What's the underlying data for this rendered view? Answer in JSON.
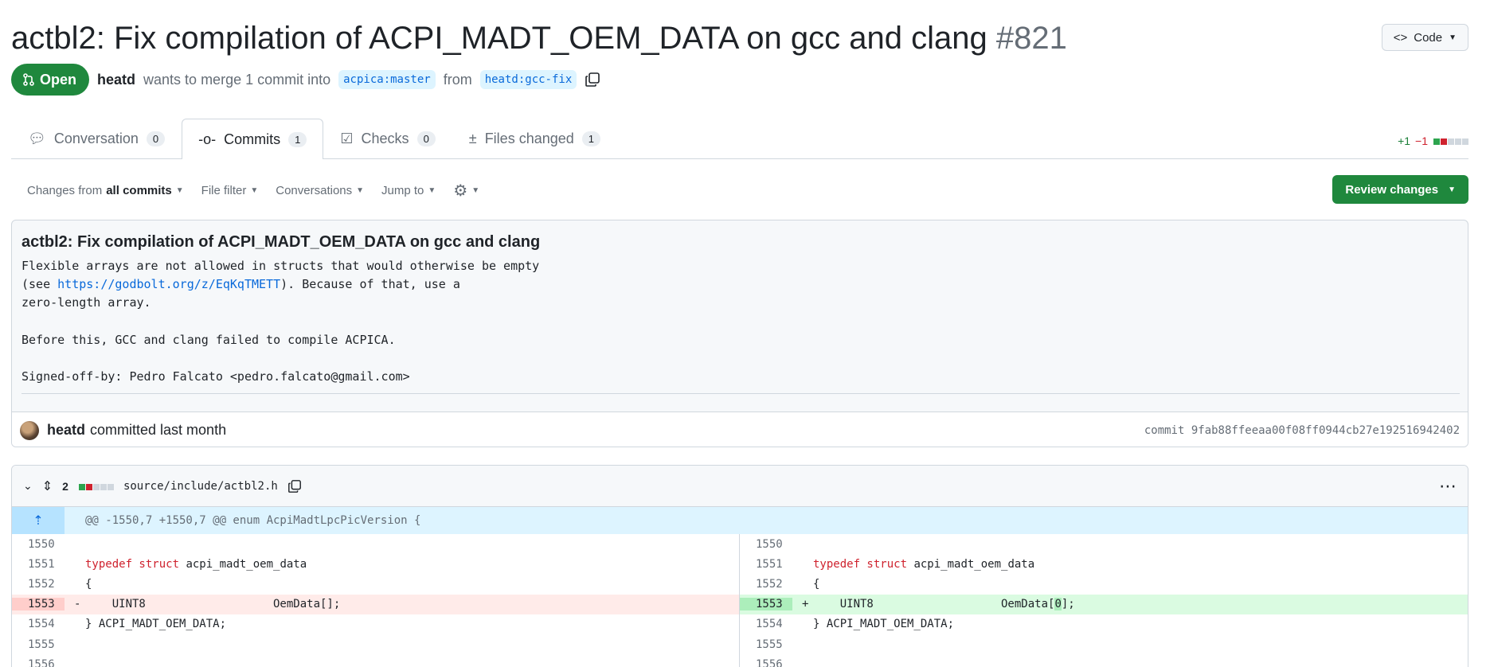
{
  "header": {
    "title": "actbl2: Fix compilation of ACPI_MADT_OEM_DATA on gcc and clang",
    "number": "#821",
    "code_button": "Code",
    "status": "Open",
    "author": "heatd",
    "merge_text": "wants to merge 1 commit into",
    "base_branch": "acpica:master",
    "from_text": "from",
    "head_branch": "heatd:gcc-fix"
  },
  "tabs": [
    {
      "label": "Conversation",
      "count": "0"
    },
    {
      "label": "Commits",
      "count": "1"
    },
    {
      "label": "Checks",
      "count": "0"
    },
    {
      "label": "Files changed",
      "count": "1"
    }
  ],
  "diffstat": {
    "additions": "+1",
    "deletions": "−1"
  },
  "toolbar": {
    "changes_prefix": "Changes from",
    "changes_value": "all commits",
    "file_filter": "File filter",
    "conversations": "Conversations",
    "jump_to": "Jump to",
    "review_button": "Review changes"
  },
  "commit": {
    "title": "actbl2: Fix compilation of ACPI_MADT_OEM_DATA on gcc and clang",
    "body_line1": "Flexible arrays are not allowed in structs that would otherwise be empty",
    "body_line2_pre": "(see ",
    "body_link": "https://godbolt.org/z/EqKqTMETT",
    "body_line2_post": "). Because of that, use a",
    "body_line3": "zero-length array.",
    "body_line5": "Before this, GCC and clang failed to compile ACPICA.",
    "body_line7": "Signed-off-by: Pedro Falcato <pedro.falcato@gmail.com>",
    "author": "heatd",
    "when": "committed last month",
    "sha_label": "commit 9fab88ffeeaa00f08ff0944cb27e192516942402"
  },
  "file": {
    "changes": "2",
    "path": "source/include/actbl2.h",
    "hunk": "@@ -1550,7 +1550,7 @@ enum AcpiMadtLpcPicVersion {",
    "left": [
      {
        "ln": "1550",
        "mk": "",
        "code": ""
      },
      {
        "ln": "1551",
        "mk": "",
        "kw": "typedef struct",
        "code": " acpi_madt_oem_data"
      },
      {
        "ln": "1552",
        "mk": "",
        "code": "{"
      },
      {
        "ln": "1553",
        "mk": "-",
        "code": "    UINT8                   OemData[];"
      },
      {
        "ln": "1554",
        "mk": "",
        "code": "} ACPI_MADT_OEM_DATA;"
      },
      {
        "ln": "1555",
        "mk": "",
        "code": ""
      },
      {
        "ln": "1556",
        "mk": "",
        "code": ""
      }
    ],
    "right": [
      {
        "ln": "1550",
        "mk": "",
        "code": ""
      },
      {
        "ln": "1551",
        "mk": "",
        "kw": "typedef struct",
        "code": " acpi_madt_oem_data"
      },
      {
        "ln": "1552",
        "mk": "",
        "code": "{"
      },
      {
        "ln": "1553",
        "mk": "+",
        "code_pre": "    UINT8                   OemData[",
        "code_hl": "0",
        "code_post": "];"
      },
      {
        "ln": "1554",
        "mk": "",
        "code": "} ACPI_MADT_OEM_DATA;"
      },
      {
        "ln": "1555",
        "mk": "",
        "code": ""
      },
      {
        "ln": "1556",
        "mk": "",
        "code": ""
      }
    ]
  },
  "colors": {
    "open_green": "#1f883d",
    "link_blue": "#0969da",
    "deletion_bg": "#ffebe9",
    "addition_bg": "#dafbe1"
  }
}
